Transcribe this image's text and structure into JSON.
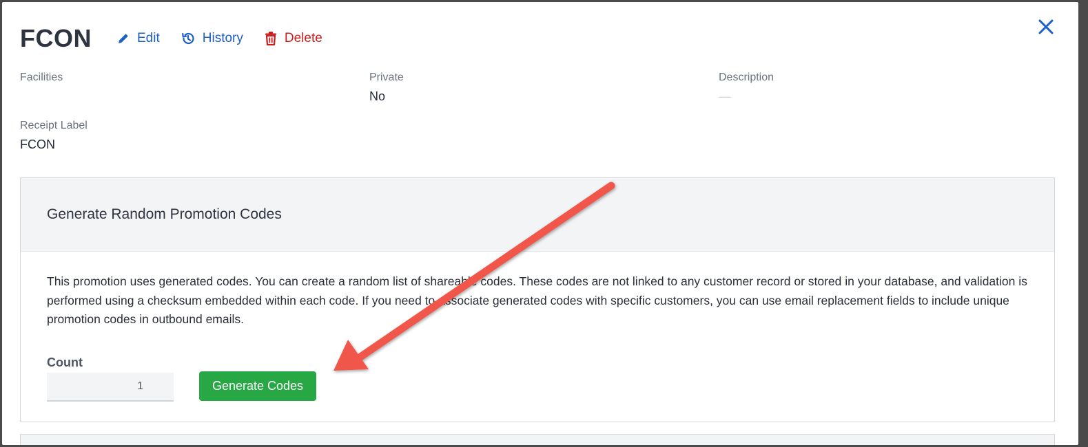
{
  "header": {
    "title": "FCON",
    "actions": {
      "edit": "Edit",
      "history": "History",
      "delete": "Delete"
    }
  },
  "fields": {
    "facilities": {
      "label": "Facilities",
      "value": ""
    },
    "private": {
      "label": "Private",
      "value": "No"
    },
    "description": {
      "label": "Description",
      "value": "—"
    },
    "receipt_label": {
      "label": "Receipt Label",
      "value": "FCON"
    }
  },
  "panel": {
    "title": "Generate Random Promotion Codes",
    "body": "This promotion uses generated codes. You can create a random list of shareable codes. These codes are not linked to any customer record or stored in your database, and validation is performed using a checksum embedded within each code. If you need to associate generated codes with specific customers, you can use email replacement fields to include unique promotion codes in outbound emails.",
    "count_label": "Count",
    "count_value": "1",
    "generate_button": "Generate Codes"
  },
  "colors": {
    "link_blue": "#1d5fc8",
    "delete_red": "#c81e1e",
    "button_green": "#28a745",
    "annotation_arrow": "#f0574a"
  },
  "icons": [
    "pencil-icon",
    "history-icon",
    "trash-icon",
    "close-icon"
  ]
}
